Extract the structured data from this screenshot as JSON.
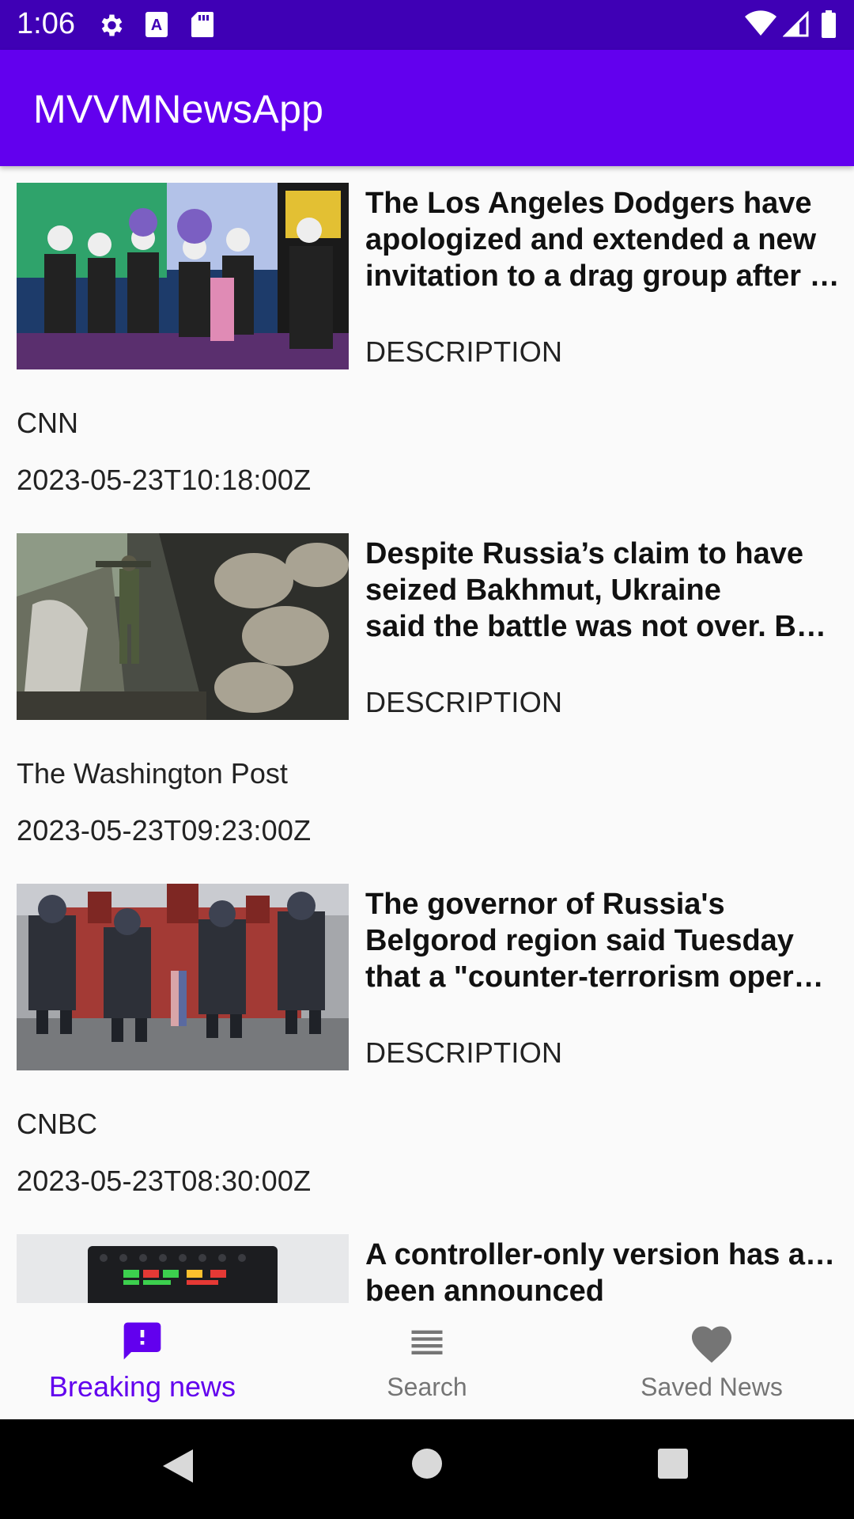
{
  "status_bar": {
    "time": "1:06",
    "icons": [
      "gear-icon",
      "a-font-icon",
      "sd-card-icon",
      "wifi-icon",
      "signal-icon",
      "battery-icon"
    ]
  },
  "app_bar": {
    "title": "MVVMNewsApp",
    "color": "#6200EE"
  },
  "articles": [
    {
      "title_lines": [
        "The Los Angeles Dodgers have",
        "apologized and extended a new",
        "invitation to a drag group after e…"
      ],
      "description": "DESCRIPTION",
      "source": "CNN",
      "published_at": "2023-05-23T10:18:00Z",
      "image": "drag-performers-photo"
    },
    {
      "title_lines": [
        "Despite Russia’s claim to have",
        "seized Bakhmut, Ukraine",
        "said the battle was not over. Bef…"
      ],
      "description": "DESCRIPTION",
      "source": "The Washington Post",
      "published_at": "2023-05-23T09:23:00Z",
      "image": "soldier-sandbags-photo"
    },
    {
      "title_lines": [
        "The governor of Russia's",
        "Belgorod region said Tuesday",
        "that a \"counter-terrorism operati…"
      ],
      "description": "DESCRIPTION",
      "source": "CNBC",
      "published_at": "2023-05-23T08:30:00Z",
      "image": "police-red-square-photo"
    },
    {
      "title_lines": [
        "A controller-only version has also",
        "been announced"
      ],
      "image": "controller-device-photo"
    }
  ],
  "bottom_nav": {
    "items": [
      {
        "label": "Breaking news",
        "icon": "breaking-news-icon",
        "active": true
      },
      {
        "label": "Search",
        "icon": "list-icon",
        "active": false
      },
      {
        "label": "Saved News",
        "icon": "heart-icon",
        "active": false
      }
    ],
    "active_color": "#6200EE",
    "inactive_color": "#757575"
  },
  "system_nav": {
    "icons": [
      "back-icon",
      "home-icon",
      "recents-icon"
    ]
  }
}
